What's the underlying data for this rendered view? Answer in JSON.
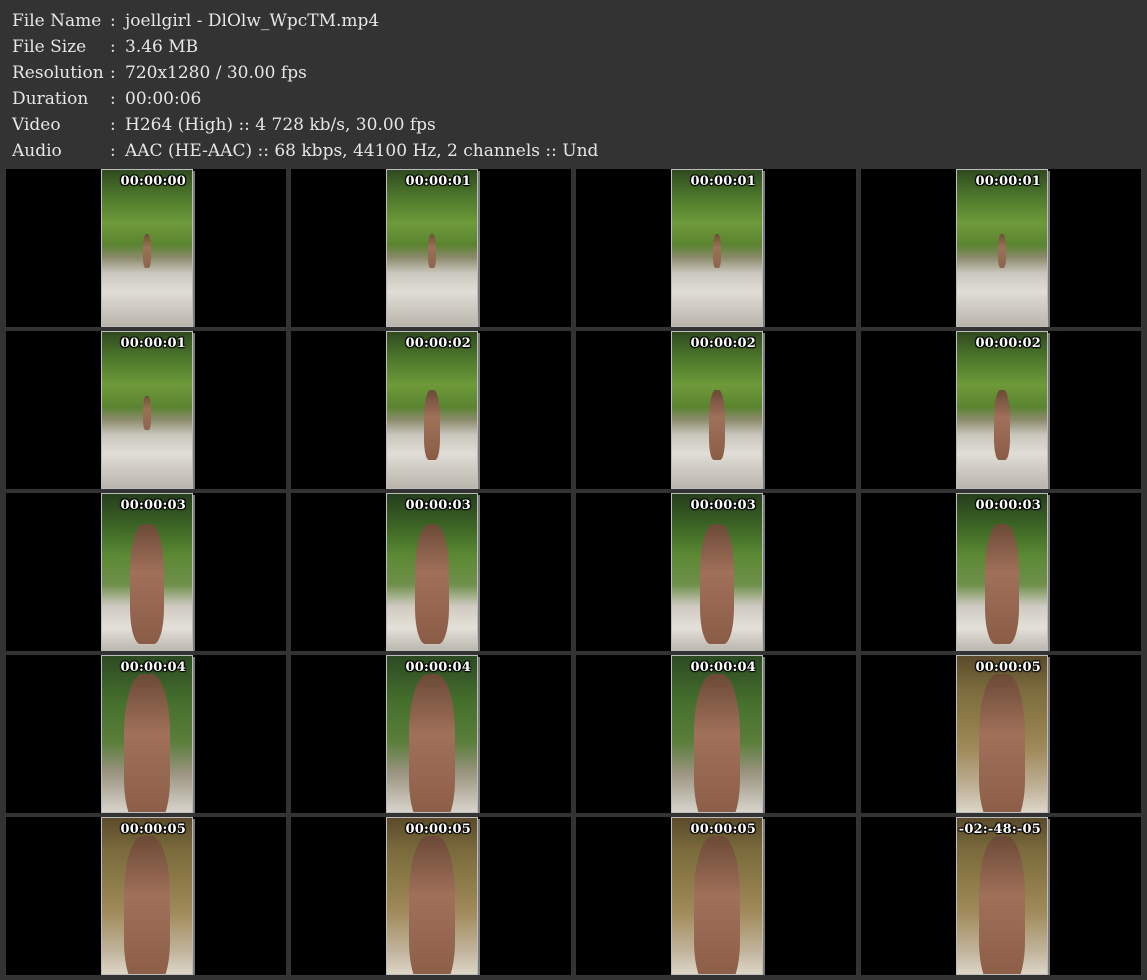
{
  "info": [
    {
      "label": "File Name",
      "sep": ":",
      "value": "joellgirl - DlOlw_WpcTM.mp4"
    },
    {
      "label": "File Size",
      "sep": ":",
      "value": "3.46 MB"
    },
    {
      "label": "Resolution",
      "sep": ":",
      "value": "720x1280 / 30.00 fps"
    },
    {
      "label": "Duration",
      "sep": ":",
      "value": "00:00:06"
    },
    {
      "label": "Video",
      "sep": ":",
      "value": "H264 (High) :: 4 728 kb/s, 30.00 fps"
    },
    {
      "label": "Audio",
      "sep": ":",
      "value": "AAC (HE-AAC) :: 68 kbps, 44100 Hz, 2 channels :: Und"
    }
  ],
  "thumbnails": [
    {
      "time": "00:00:00"
    },
    {
      "time": "00:00:01"
    },
    {
      "time": "00:00:01"
    },
    {
      "time": "00:00:01"
    },
    {
      "time": "00:00:01"
    },
    {
      "time": "00:00:02"
    },
    {
      "time": "00:00:02"
    },
    {
      "time": "00:00:02"
    },
    {
      "time": "00:00:03"
    },
    {
      "time": "00:00:03"
    },
    {
      "time": "00:00:03"
    },
    {
      "time": "00:00:03"
    },
    {
      "time": "00:00:04"
    },
    {
      "time": "00:00:04"
    },
    {
      "time": "00:00:04"
    },
    {
      "time": "00:00:05"
    },
    {
      "time": "00:00:05"
    },
    {
      "time": "00:00:05"
    },
    {
      "time": "00:00:05"
    },
    {
      "time": "-02:-48:-05"
    }
  ],
  "colors": {
    "background": "#333333",
    "cell_background": "#000000",
    "text": "#e6e6e6"
  }
}
